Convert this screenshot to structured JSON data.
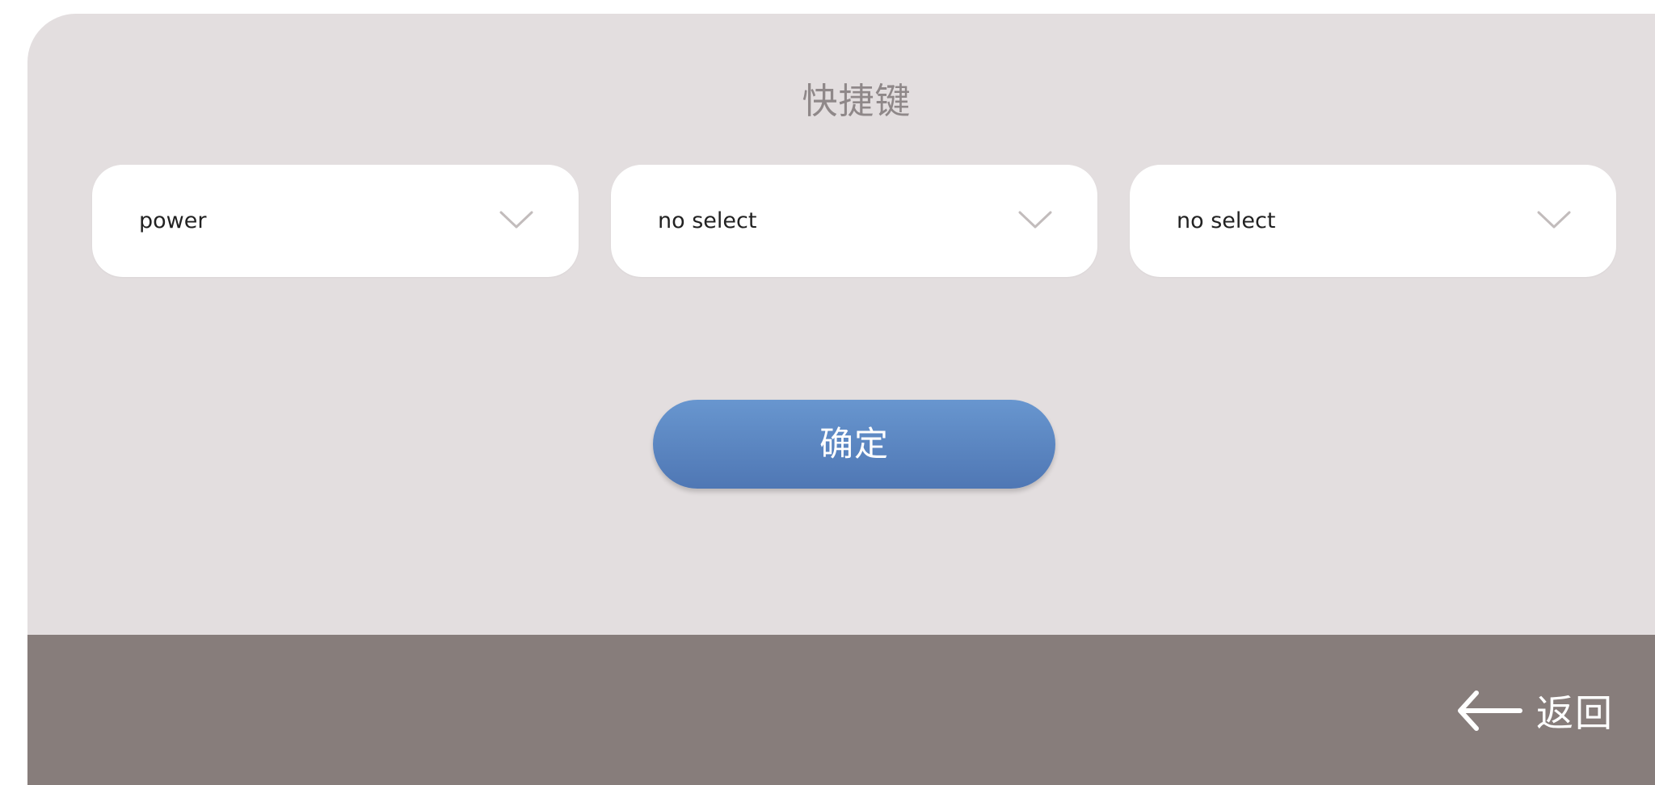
{
  "title": "快捷键",
  "selects": [
    {
      "value": "power",
      "icon": "chevron-down-icon"
    },
    {
      "value": "no select",
      "icon": "chevron-down-icon"
    },
    {
      "value": "no select",
      "icon": "chevron-down-icon"
    }
  ],
  "confirm_label": "确定",
  "back": {
    "label": "返回",
    "icon": "arrow-left-icon"
  },
  "colors": {
    "panel_bg": "#e3dedf",
    "bottom_bar": "#877d7b",
    "confirm_top": "#6896cf",
    "confirm_bottom": "#4f77b4",
    "title_text": "#8f8889"
  }
}
